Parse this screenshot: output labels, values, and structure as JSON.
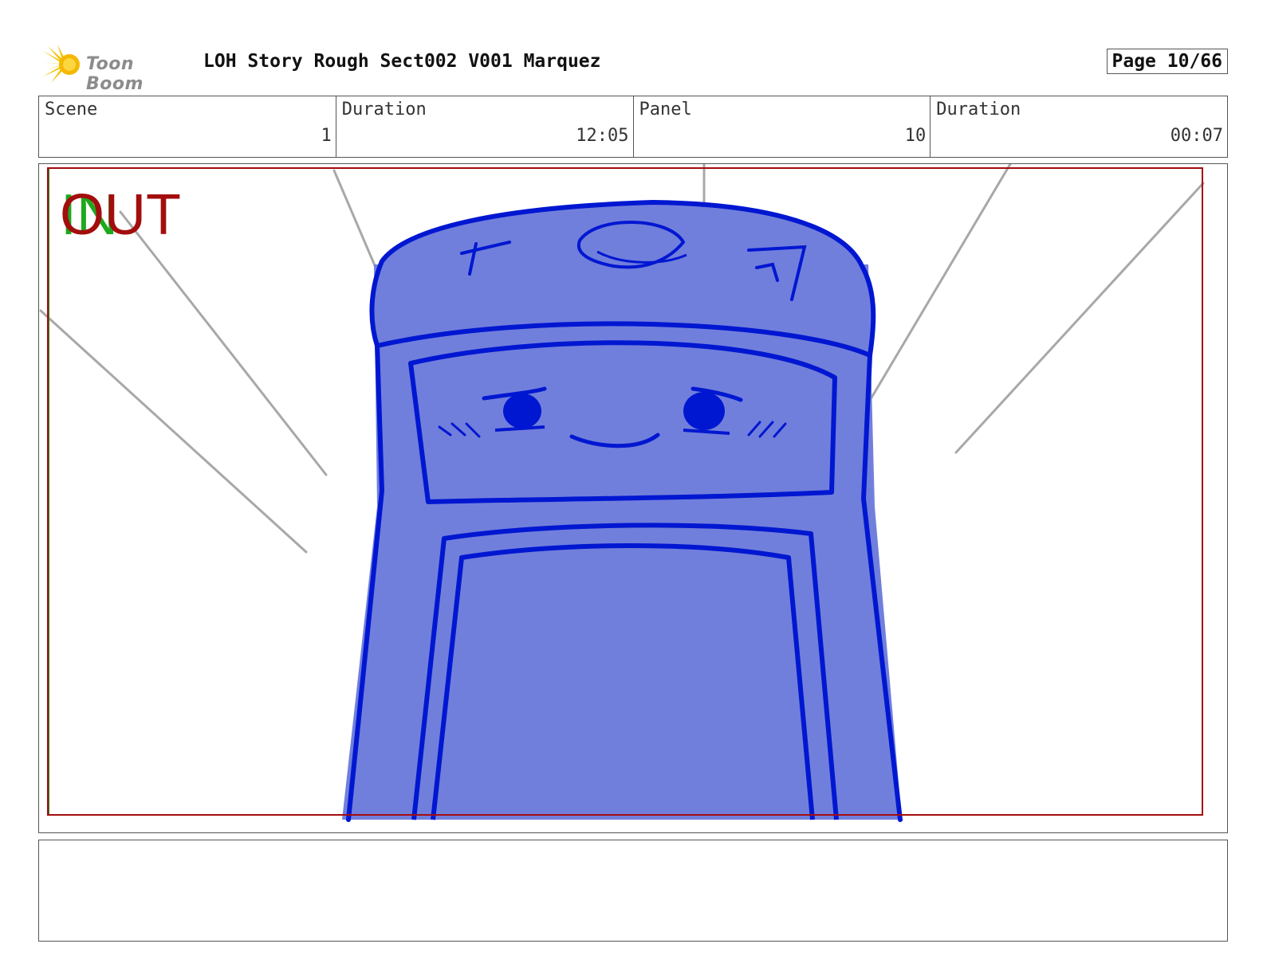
{
  "header": {
    "logo_text": "Toon Boom",
    "title": "LOH Story Rough Sect002 V001 Marquez",
    "page_label": "Page 10/66"
  },
  "info": {
    "scene_label": "Scene",
    "scene_value": "1",
    "scene_duration_label": "Duration",
    "scene_duration_value": "12:05",
    "panel_label": "Panel",
    "panel_value": "10",
    "panel_duration_label": "Duration",
    "panel_duration_value": "00:07"
  },
  "panel": {
    "in_marker": "IN",
    "out_marker": "OUT"
  },
  "colors": {
    "safe_frame_red": "#a30d0d",
    "safe_frame_green": "#2a8a2a",
    "character_fill": "#717fdc",
    "character_line": "#0017d1",
    "speed_lines": "#a8a8a8"
  },
  "notes": {
    "text": ""
  }
}
